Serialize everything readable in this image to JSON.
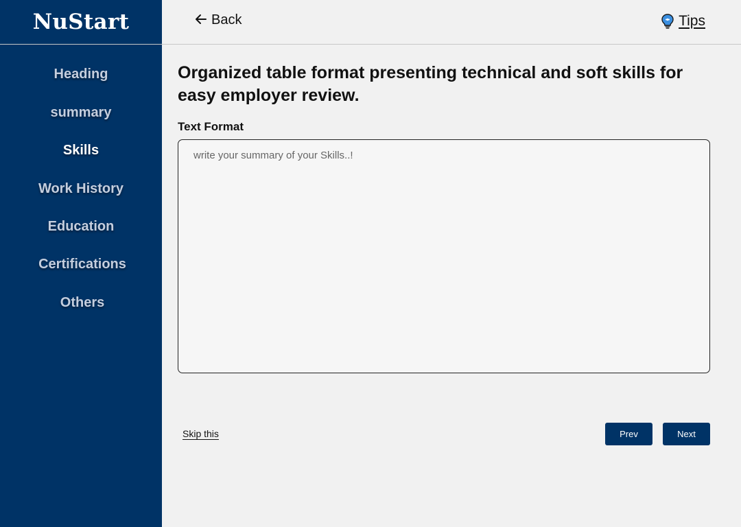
{
  "brand": {
    "name": "NuStart"
  },
  "sidebar": {
    "items": [
      {
        "label": "Heading",
        "active": false
      },
      {
        "label": "summary",
        "active": false
      },
      {
        "label": "Skills",
        "active": true
      },
      {
        "label": "Work History",
        "active": false
      },
      {
        "label": "Education",
        "active": false
      },
      {
        "label": "Certifications",
        "active": false
      },
      {
        "label": "Others",
        "active": false
      }
    ]
  },
  "header": {
    "back_label": "Back",
    "back_icon": "arrow-left-icon",
    "tips_label": "Tips",
    "tips_icon": "lightbulb-icon"
  },
  "main": {
    "title": "Organized table format presenting technical and soft skills for easy employer review.",
    "field_label": "Text Format",
    "textarea": {
      "value": "",
      "placeholder": "write your summary of your Skills..!"
    },
    "skip_label": "Skip this",
    "prev_label": "Prev",
    "next_label": "Next"
  },
  "colors": {
    "sidebar_bg": "#003366",
    "page_bg": "#f1f1f1",
    "button_bg": "#003366",
    "active_nav": "#ffffff",
    "inactive_nav": "#c5cede"
  }
}
